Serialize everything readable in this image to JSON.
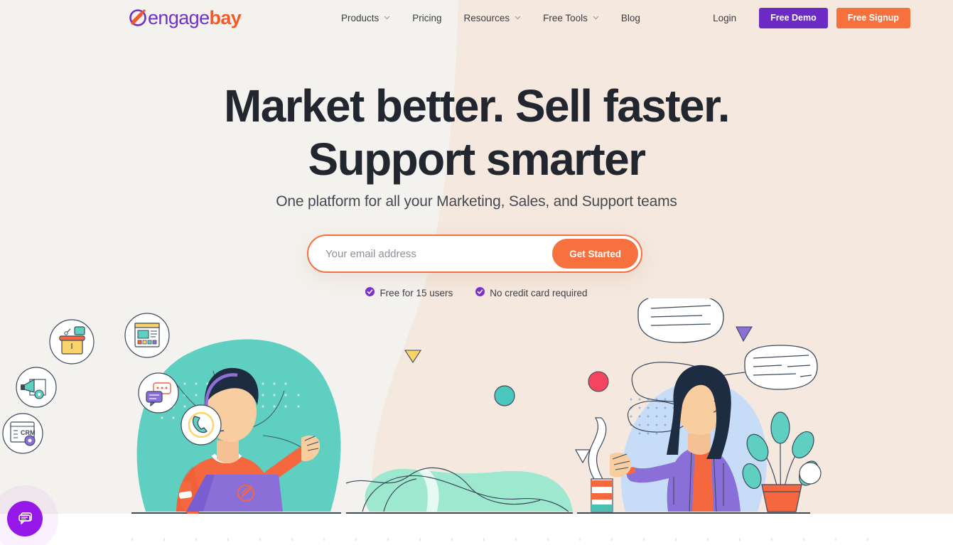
{
  "brand": {
    "logo_engage": "engage",
    "logo_bay": "bay",
    "logo_icon": "engagebay-swoosh-icon",
    "purple": "#7031c4",
    "orange": "#f15b29"
  },
  "nav": {
    "items": [
      {
        "label": "Products",
        "has_dropdown": true
      },
      {
        "label": "Pricing",
        "has_dropdown": false
      },
      {
        "label": "Resources",
        "has_dropdown": true
      },
      {
        "label": "Free Tools",
        "has_dropdown": true
      },
      {
        "label": "Blog",
        "has_dropdown": false
      }
    ],
    "login_label": "Login",
    "demo_label": "Free Demo",
    "signup_label": "Free Signup",
    "demo_color": "#6b2bc4",
    "signup_color": "#f7713f"
  },
  "hero": {
    "headline_line1": "Market better. Sell faster.",
    "headline_line2": "Support smarter",
    "subheadline": "One platform for all your Marketing, Sales, and Support teams",
    "bg_left": "#f4f2ee",
    "bg_right": "#f5e8de"
  },
  "form": {
    "placeholder": "Your email address",
    "value": "",
    "cta_label": "Get Started",
    "border_color": "#f7713f"
  },
  "assurances": [
    {
      "icon": "check-circle-icon",
      "label": "Free for 15 users"
    },
    {
      "icon": "check-circle-icon",
      "label": "No credit card required"
    }
  ],
  "illustration": {
    "left_scene": "support-agent-with-headset-and-laptop",
    "right_scene": "woman-with-speech-bubbles-and-plant",
    "bubble_icons": [
      "help-desk-icon",
      "landing-page-icon",
      "marketing-automation-icon",
      "crm-icon",
      "live-chat-icon",
      "telephony-icon"
    ]
  },
  "chat_widget": {
    "icon": "chat-bubble-icon",
    "color": "#9518e8"
  }
}
